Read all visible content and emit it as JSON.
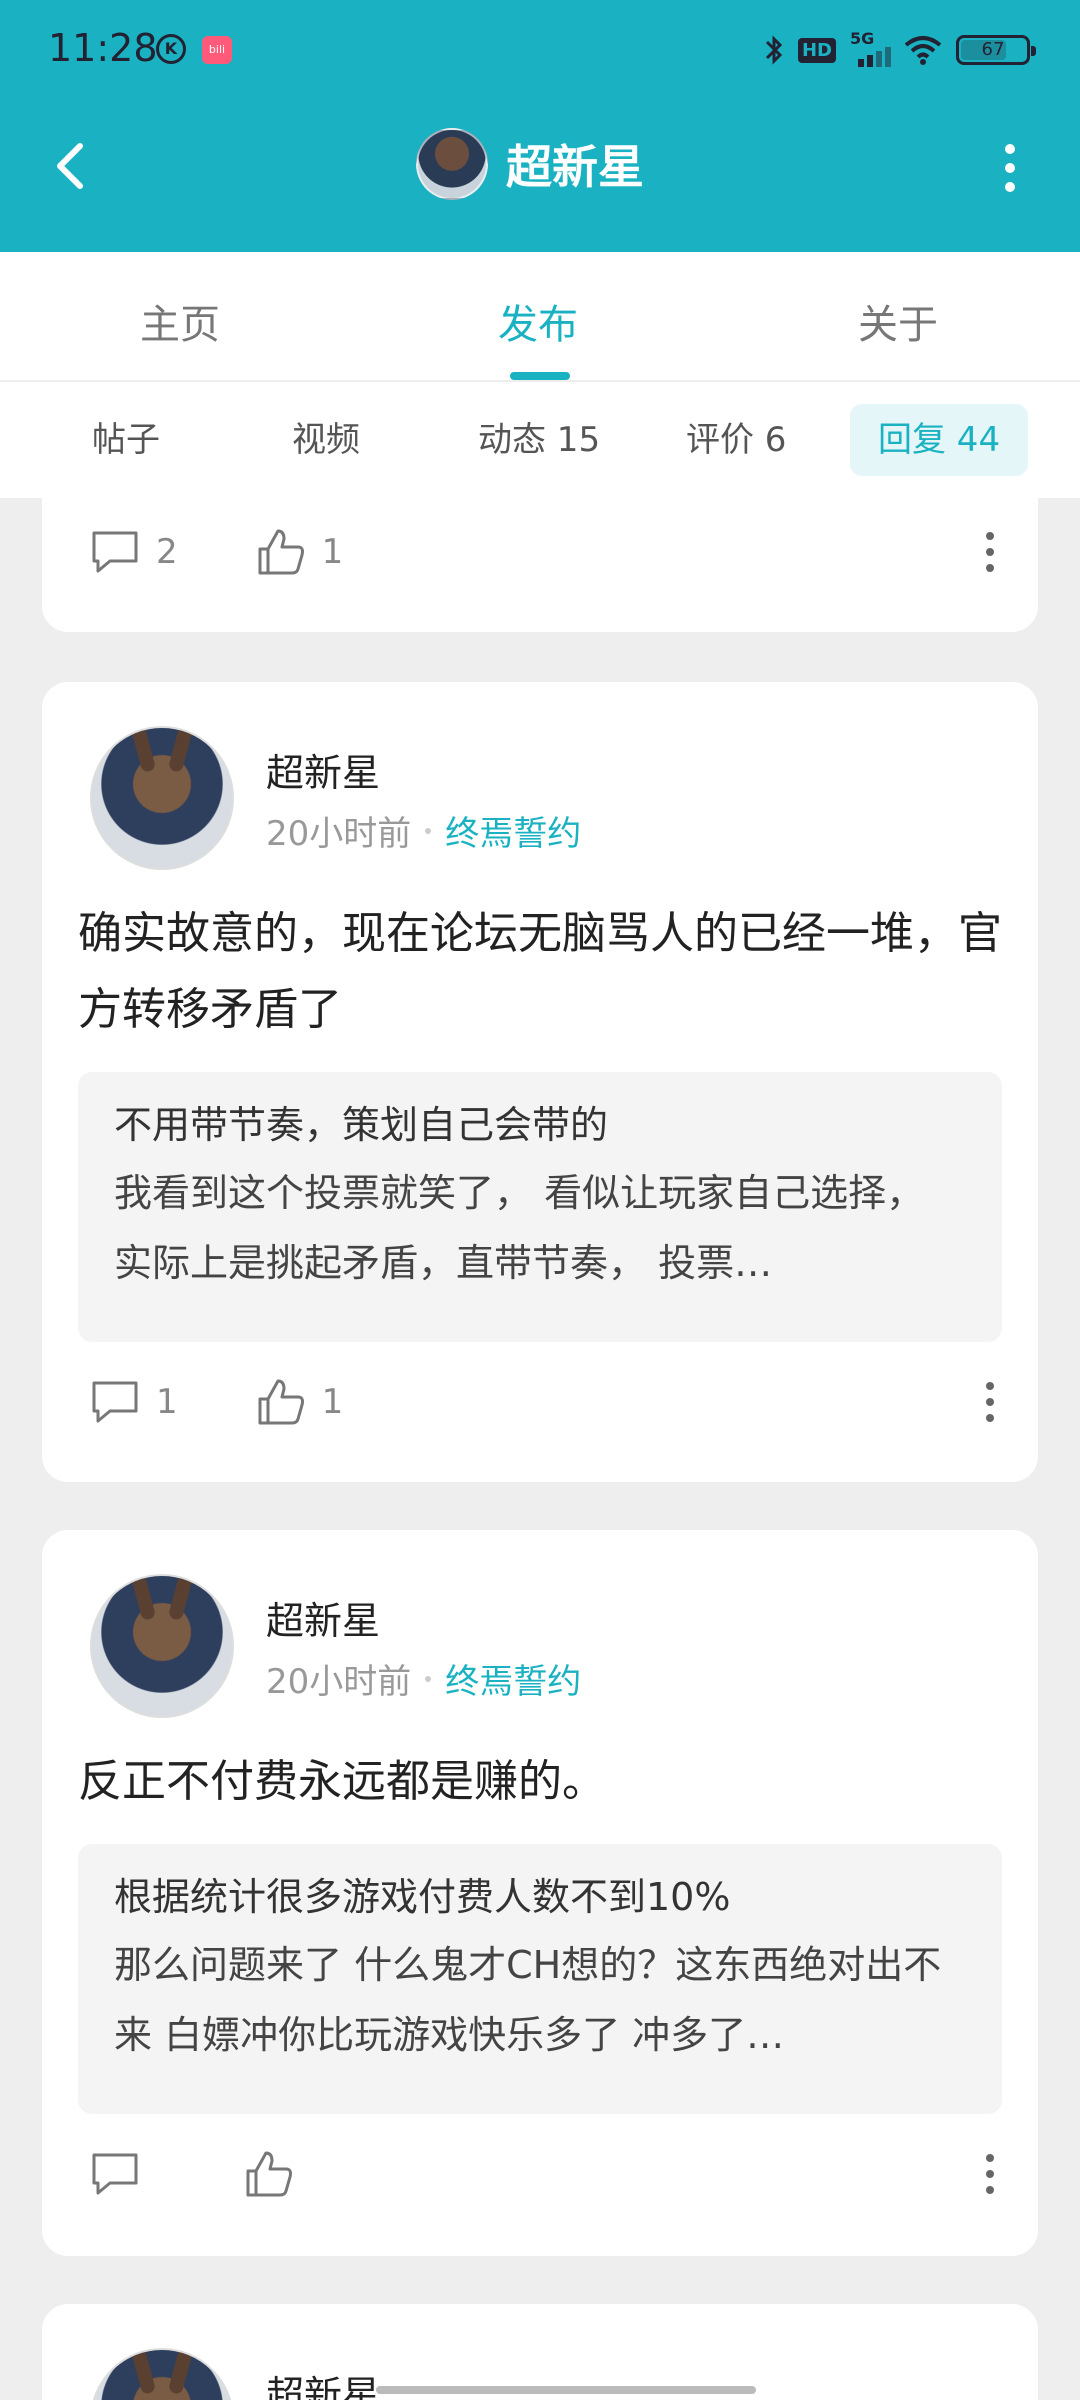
{
  "status": {
    "time": "11:28",
    "battery": "67",
    "network": "5G",
    "hd": "HD",
    "app_badge": "bili"
  },
  "header": {
    "title": "超新星"
  },
  "tabs": [
    "主页",
    "发布",
    "关于"
  ],
  "subtabs": [
    "帖子",
    "视频",
    "动态 15",
    "评价 6",
    "回复 44"
  ],
  "partial_card": {
    "comments": "2",
    "likes": "1"
  },
  "posts": [
    {
      "author": "超新星",
      "time": "20小时前",
      "forum": "终焉誓约",
      "text": "确实故意的，现在论坛无脑骂人的已经一堆，官方转移矛盾了",
      "quote_title": "不用带节奏，策划自己会带的",
      "quote_body": "我看到这个投票就笑了， 看似让玩家自己选择， 实际上是挑起矛盾，直带节奏， 投票…",
      "comments": "1",
      "likes": "1"
    },
    {
      "author": "超新星",
      "time": "20小时前",
      "forum": "终焉誓约",
      "text": "反正不付费永远都是赚的。",
      "quote_title": "根据统计很多游戏付费人数不到10%",
      "quote_body": "那么问题来了 什么鬼才CH想的？这东西绝对出不来  白嫖冲你比玩游戏快乐多了  冲多了…",
      "comments": "",
      "likes": ""
    },
    {
      "author": "超新星"
    }
  ],
  "colors": {
    "accent": "#1ab2c2",
    "background": "#eeeeee"
  }
}
